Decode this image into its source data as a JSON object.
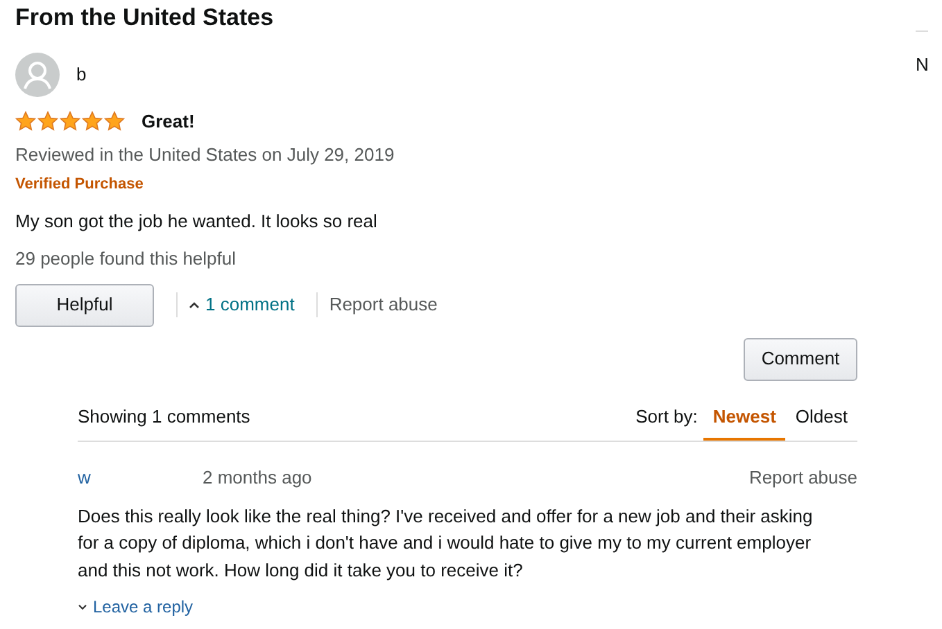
{
  "heading": "From the United States",
  "review": {
    "author": "b",
    "stars": 5,
    "title": "Great!",
    "meta": "Reviewed in the United States on July 29, 2019",
    "badge": "Verified Purchase",
    "body": "My son got the job he wanted. It looks so real",
    "helpful_count": "29 people found this helpful",
    "helpful_button": "Helpful",
    "comments_link": {
      "label": "1 comment",
      "expanded": true
    },
    "report": "Report abuse"
  },
  "comment_button": "Comment",
  "comments": {
    "summary": "Showing 1 comments",
    "sort_label": "Sort by:",
    "sort_options": [
      {
        "label": "Newest",
        "selected": true
      },
      {
        "label": "Oldest",
        "selected": false
      }
    ],
    "items": [
      {
        "author": "w",
        "time": "2 months ago",
        "report": "Report abuse",
        "body": "Does this really look like the real thing? I've received and offer for a new job and their asking for a copy of diploma, which i don't have and i would hate to give my to my current employer and this not work. How long did it take you to receive it?",
        "reply": "Leave a reply"
      }
    ]
  },
  "side_text": "N"
}
